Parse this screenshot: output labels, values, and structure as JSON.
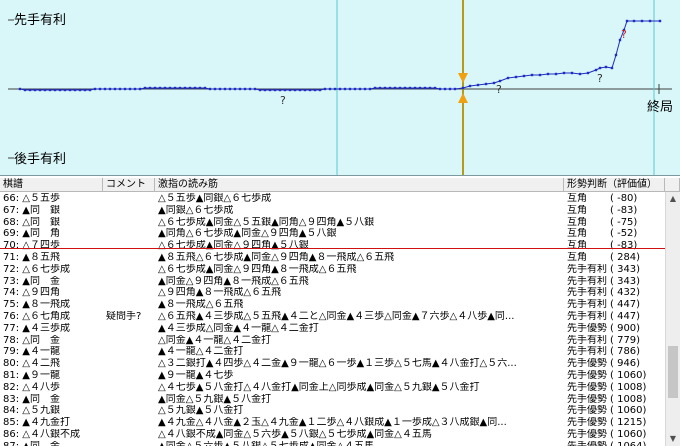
{
  "graph": {
    "label_sente": "先手有利",
    "label_gote": "後手有利",
    "label_end": "終局",
    "colors": {
      "background": "#d9f6f8",
      "line": "#1f2dc0",
      "current_marker": "#b89a1a",
      "marker_arrow": "#f0a010",
      "question_mark": "#333333",
      "bad_move_mark": "#d02020"
    }
  },
  "table": {
    "headers": {
      "move": "棋譜",
      "comment": "コメント",
      "pv": "激指の読み筋",
      "judgement": "形勢判断（評価値）"
    },
    "rows": [
      {
        "move": "66: △５五歩",
        "comment": "",
        "pv": "△５五歩▲同銀△６七歩成",
        "judge": "互角",
        "score": "(    -80)"
      },
      {
        "move": "67: ▲同　銀",
        "comment": "",
        "pv": "▲同銀△６七歩成",
        "judge": "互角",
        "score": "(    -83)"
      },
      {
        "move": "68: △同　銀",
        "comment": "",
        "pv": "△６七歩成▲同金△５五銀▲同角△９四角▲５八銀",
        "judge": "互角",
        "score": "(    -75)"
      },
      {
        "move": "69: ▲同　角",
        "comment": "",
        "pv": "▲同角△６七歩成▲同金△９四角▲５八銀",
        "judge": "互角",
        "score": "(    -52)"
      },
      {
        "move": "70: △７四歩",
        "comment": "",
        "pv": "△６七歩成▲同金△９四角▲５八銀",
        "judge": "互角",
        "score": "(    -83)"
      },
      {
        "move": "71: ▲８五飛",
        "comment": "",
        "pv": "▲８五飛△６七歩成▲同金△９四角▲８一飛成△６五飛",
        "judge": "互角",
        "score": "(    284)"
      },
      {
        "move": "72: △６七歩成",
        "comment": "",
        "pv": "△６七歩成▲同金△９四角▲８一飛成△６五飛",
        "judge": "先手有利",
        "score": "(    343)"
      },
      {
        "move": "73: ▲同　金",
        "comment": "",
        "pv": "▲同金△９四角▲８一飛成△６五飛",
        "judge": "先手有利",
        "score": "(    343)"
      },
      {
        "move": "74: △９四角",
        "comment": "",
        "pv": "△９四角▲８一飛成△６五飛",
        "judge": "先手有利",
        "score": "(    432)"
      },
      {
        "move": "75: ▲８一飛成",
        "comment": "",
        "pv": "▲８一飛成△６五飛",
        "judge": "先手有利",
        "score": "(    447)"
      },
      {
        "move": "76: △６七角成",
        "comment": "疑問手?",
        "pv": "△６五飛▲４三歩成△５五飛▲４二と△同金▲４三歩△同金▲７六歩△４八歩▲同...",
        "judge": "先手有利",
        "score": "(    447)"
      },
      {
        "move": "77: ▲４三歩成",
        "comment": "",
        "pv": "▲４三歩成△同金▲４一龍△４二金打",
        "judge": "先手優勢",
        "score": "(    900)"
      },
      {
        "move": "78: △同　金",
        "comment": "",
        "pv": "△同金▲４一龍△４二金打",
        "judge": "先手有利",
        "score": "(    779)"
      },
      {
        "move": "79: ▲４一龍",
        "comment": "",
        "pv": "▲４一龍△４二金打",
        "judge": "先手有利",
        "score": "(    786)"
      },
      {
        "move": "80: △４二飛",
        "comment": "",
        "pv": "△３二銀打▲４四歩△４二金▲９一龍△６一歩▲１三歩△５七馬▲４八金打△５六...",
        "judge": "先手優勢",
        "score": "(    946)"
      },
      {
        "move": "81: ▲９一龍",
        "comment": "",
        "pv": "▲９一龍▲４七歩",
        "judge": "先手優勢",
        "score": "(   1060)"
      },
      {
        "move": "82: △４八歩",
        "comment": "",
        "pv": "△４七歩▲５八金打△４八金打▲同金上△同歩成▲同金△５九銀▲５八金打",
        "judge": "先手優勢",
        "score": "(   1008)"
      },
      {
        "move": "83: ▲同　金",
        "comment": "",
        "pv": "▲同金△５九銀▲５八金打",
        "judge": "先手優勢",
        "score": "(   1008)"
      },
      {
        "move": "84: △５九銀",
        "comment": "",
        "pv": "△５九銀▲５八金打",
        "judge": "先手優勢",
        "score": "(   1060)"
      },
      {
        "move": "85: ▲４九金打",
        "comment": "",
        "pv": "▲４九金△４八金▲２玉△４九金▲１二歩△４八銀成▲１一歩成△３八成銀▲同...",
        "judge": "先手優勢",
        "score": "(   1215)"
      },
      {
        "move": "86: △４八銀不成",
        "comment": "",
        "pv": "△４八銀不成▲同金△５六歩▲５八銀△５七歩成▲同金△４五馬",
        "judge": "先手優勢",
        "score": "(   1060)"
      },
      {
        "move": "87: ▲同　金",
        "comment": "",
        "pv": "▲同金△５六歩▲５八銀△５七歩成▲同金△４五馬",
        "judge": "先手優勢",
        "score": "(   1064)"
      },
      {
        "move": "88: △５六歩",
        "comment": "",
        "pv": "△５六歩▲５八銀△５七歩成▲同金△４五馬",
        "judge": "先手優勢",
        "score": "(   1148)"
      }
    ]
  }
}
